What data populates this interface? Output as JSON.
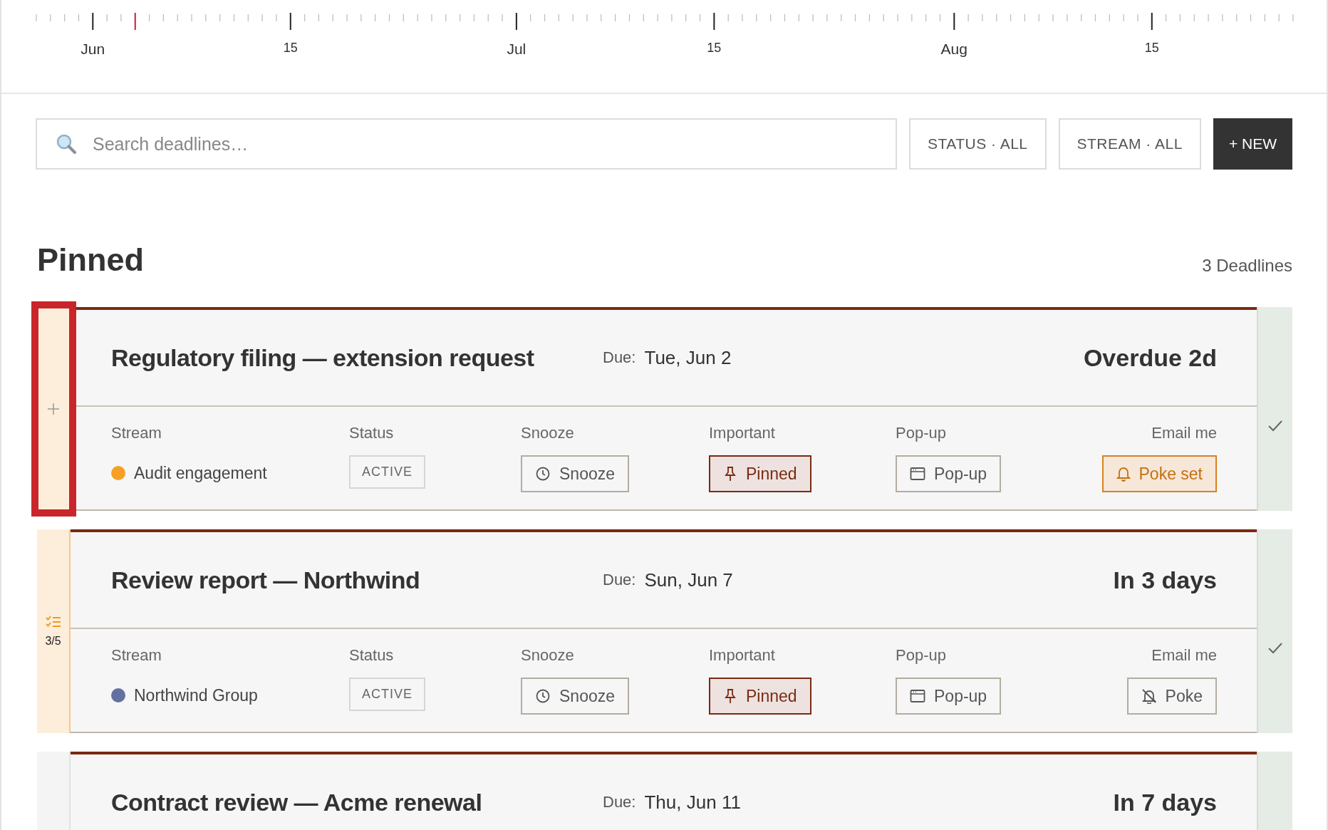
{
  "timeline": {
    "today_marked": true,
    "labels": [
      {
        "text": "Jun",
        "kind": "month"
      },
      {
        "text": "15",
        "kind": "day"
      },
      {
        "text": "Jul",
        "kind": "month"
      },
      {
        "text": "15",
        "kind": "day"
      },
      {
        "text": "Aug",
        "kind": "month"
      },
      {
        "text": "15",
        "kind": "day"
      }
    ]
  },
  "search": {
    "placeholder": "Search deadlines…"
  },
  "filters": [
    "STATUS · ALL",
    "STREAM · ALL"
  ],
  "new_button": "+ NEW",
  "section": {
    "title": "Pinned",
    "count": "3 Deadlines"
  },
  "cards": [
    {
      "title": "Regulatory filing — extension request",
      "due_label": "Due:",
      "due": "Tue, Jun 2",
      "countdown": "Overdue 2d",
      "side": {
        "kind": "add",
        "focused": true
      },
      "fields": {
        "stream_label": "Stream",
        "stream": {
          "name": "Audit engagement",
          "color": "#f5a024"
        },
        "status_label": "Status",
        "status": "ACTIVE",
        "snooze_label": "Snooze",
        "snooze": "Snooze",
        "important_label": "Important",
        "important": {
          "text": "Pinned",
          "on": true
        },
        "popup_label": "Pop-up",
        "popup": {
          "text": "Pop-up",
          "on": false
        },
        "email_label": "Email me",
        "email": {
          "text": "Poke set",
          "on": true
        }
      }
    },
    {
      "title": "Review report — Northwind",
      "due_label": "Due:",
      "due": "Sun, Jun 7",
      "countdown": "In 3 days",
      "side": {
        "kind": "checklist",
        "progress": "3/5",
        "focused": false
      },
      "fields": {
        "stream_label": "Stream",
        "stream": {
          "name": "Northwind Group",
          "color": "#6470a0"
        },
        "status_label": "Status",
        "status": "ACTIVE",
        "snooze_label": "Snooze",
        "snooze": "Snooze",
        "important_label": "Important",
        "important": {
          "text": "Pinned",
          "on": true
        },
        "popup_label": "Pop-up",
        "popup": {
          "text": "Pop-up",
          "on": false
        },
        "email_label": "Email me",
        "email": {
          "text": "Poke",
          "on": false
        }
      }
    },
    {
      "title": "Contract review — Acme renewal",
      "due_label": "Due:",
      "due": "Thu, Jun 11",
      "countdown": "In 7 days",
      "side": {
        "kind": "empty",
        "focused": false
      }
    }
  ]
}
